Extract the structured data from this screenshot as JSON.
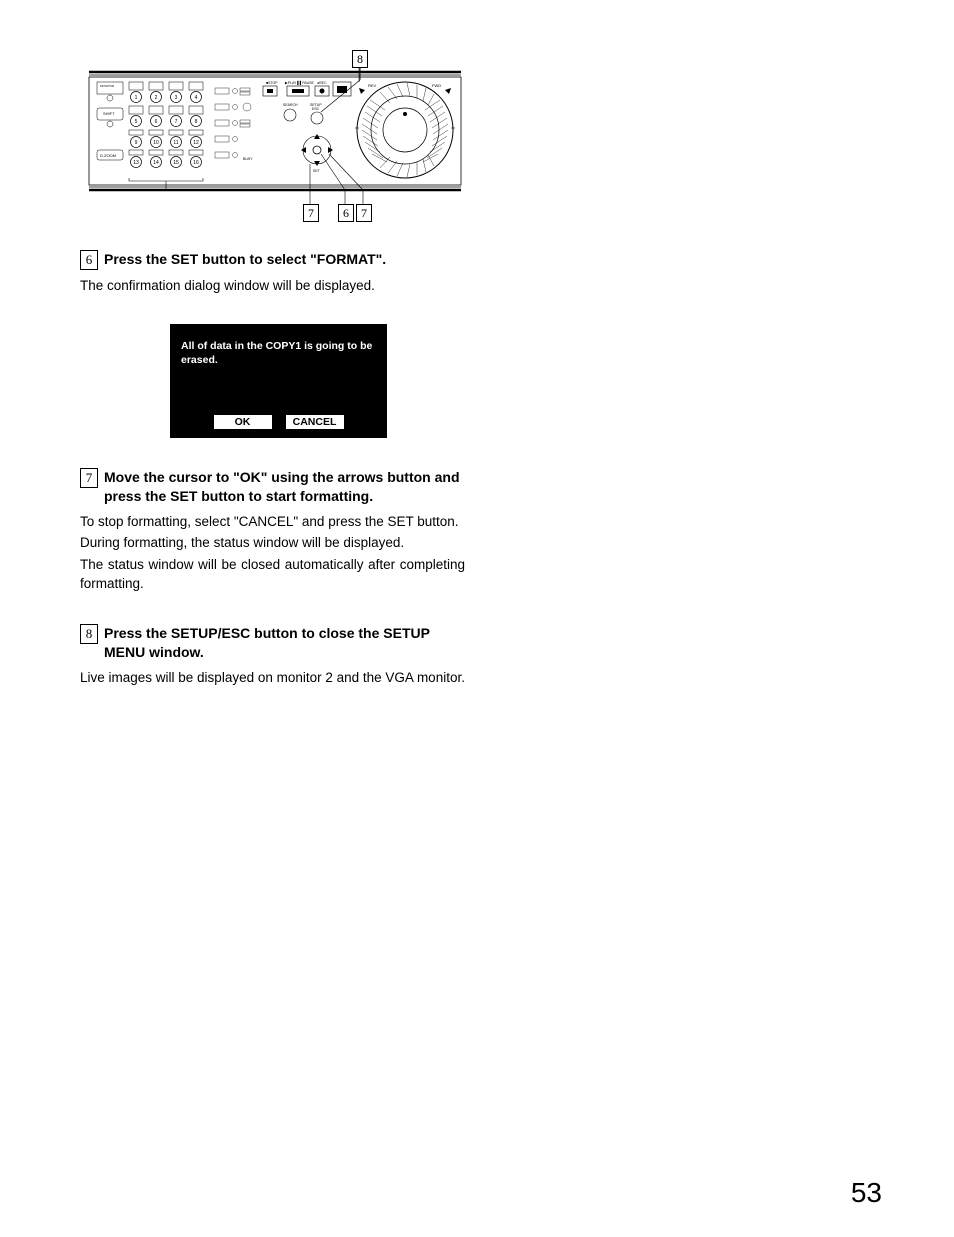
{
  "diagram": {
    "callout_top": "8",
    "callout_bottom_left": "7",
    "callout_bottom_mid": "6",
    "callout_bottom_right": "7",
    "panel_labels": {
      "stop": "STOP",
      "play_pause": "PLAY PAUSE",
      "rec": "REC",
      "rev": "REV",
      "fwd": "FWD",
      "search": "SEARCH",
      "setup": "SETUP",
      "set": "SET",
      "busy": "BUSY",
      "d_zoom": "D.ZOOM",
      "shift": "SHIFT"
    },
    "numbered_buttons": [
      "1",
      "2",
      "3",
      "4",
      "5",
      "6",
      "7",
      "8",
      "9",
      "10",
      "11",
      "12",
      "13",
      "14",
      "15",
      "16"
    ]
  },
  "step6": {
    "num": "6",
    "title": "Press the SET button to select \"FORMAT\".",
    "body": "The confirmation dialog window will be displayed."
  },
  "dialog": {
    "message": "All of data in the COPY1 is going to be erased.",
    "ok": "OK",
    "cancel": "CANCEL"
  },
  "step7": {
    "num": "7",
    "title": "Move the cursor to \"OK\" using the arrows button and press the SET button to start formatting.",
    "body1": "To stop formatting, select \"CANCEL\" and press the SET button.",
    "body2": "During formatting, the status window will be displayed.",
    "body3": "The status window will be closed automatically after completing formatting."
  },
  "step8": {
    "num": "8",
    "title": "Press the SETUP/ESC button to close the SETUP MENU window.",
    "body": "Live images will be displayed on monitor 2 and the VGA monitor."
  },
  "page_number": "53"
}
